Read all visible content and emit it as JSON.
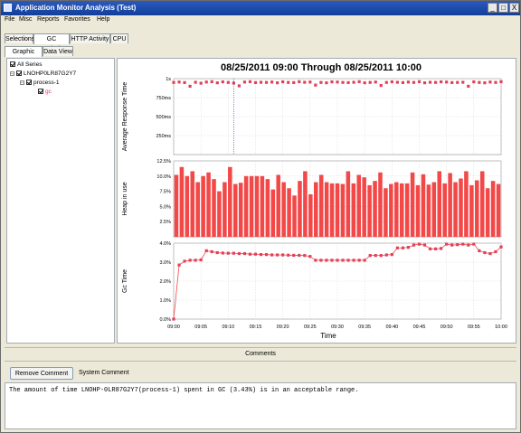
{
  "window": {
    "title": "Application Monitor Analysis (Test)",
    "minimize": "_",
    "maximize": "□",
    "close": "X"
  },
  "menu": [
    "File",
    "Misc",
    "Reports",
    "Favorites",
    "Help"
  ],
  "top_tabs": [
    {
      "label": "Selections",
      "active": false
    },
    {
      "label": "GC Analysis",
      "active": true
    },
    {
      "label": "HTTP Activity",
      "active": false
    },
    {
      "label": "CPU",
      "active": false
    }
  ],
  "sub_tabs": [
    {
      "label": "Graphic View",
      "active": true
    },
    {
      "label": "Data View",
      "active": false
    }
  ],
  "tree": {
    "root": "All Series",
    "host": "LNOHP0LR87G2Y7",
    "process": "process-1",
    "series": "gc",
    "expander": "−"
  },
  "comments": {
    "header": "Comments",
    "remove_button": "Remove Comment",
    "system_label": "System Comment",
    "text": "The amount of time LNOHP-0LR87G2Y7(process-1) spent in GC (3.43%) is in an acceptable range."
  },
  "colors": {
    "series": "#f24848",
    "marker": "#e0405a",
    "accent": "#1f49a8"
  },
  "chart_data": {
    "title": "08/25/2011 09:00 Through 08/25/2011 10:00",
    "xlabel": "Time",
    "x_ticks": [
      "09:00",
      "09:05",
      "09:10",
      "09:15",
      "09:20",
      "09:25",
      "09:30",
      "09:35",
      "09:40",
      "09:45",
      "09:50",
      "09:55",
      "10:00"
    ],
    "x_range_minutes": [
      0,
      60
    ],
    "panels": [
      {
        "type": "scatter",
        "ylabel": "Average Response Time",
        "y_ticks": [
          "1s",
          "750ms",
          "500ms",
          "250ms"
        ],
        "y_tick_values": [
          1000,
          750,
          500,
          250
        ],
        "ylim": [
          0,
          1000
        ],
        "x": [
          0,
          1,
          2,
          3,
          4,
          5,
          6,
          7,
          8,
          9,
          10,
          11,
          12,
          13,
          14,
          15,
          16,
          17,
          18,
          19,
          20,
          21,
          22,
          23,
          24,
          25,
          26,
          27,
          28,
          29,
          30,
          31,
          32,
          33,
          34,
          35,
          36,
          37,
          38,
          39,
          40,
          41,
          42,
          43,
          44,
          45,
          46,
          47,
          48,
          49,
          50,
          51,
          52,
          53,
          54,
          55,
          56,
          57,
          58,
          59,
          60
        ],
        "values": [
          950,
          955,
          948,
          900,
          952,
          940,
          955,
          960,
          945,
          958,
          950,
          942,
          905,
          955,
          960,
          948,
          952,
          950,
          955,
          945,
          958,
          950,
          948,
          960,
          952,
          955,
          915,
          950,
          945,
          958,
          955,
          950,
          948,
          952,
          960,
          945,
          950,
          955,
          910,
          950,
          958,
          952,
          948,
          955,
          950,
          960,
          945,
          952,
          950,
          958,
          955,
          948,
          950,
          952,
          900,
          958,
          950,
          945,
          955,
          950,
          960
        ]
      },
      {
        "type": "bar",
        "ylabel": "Heap in use",
        "y_ticks": [
          "12.5%",
          "10.0%",
          "7.5%",
          "5.0%",
          "2.5%"
        ],
        "y_tick_values": [
          12.5,
          10.0,
          7.5,
          5.0,
          2.5
        ],
        "ylim": [
          0,
          12.5
        ],
        "values": [
          10.2,
          11.5,
          10.0,
          10.8,
          9.0,
          10.0,
          10.6,
          9.5,
          7.5,
          9.0,
          11.5,
          8.7,
          8.9,
          10.0,
          10.0,
          10.0,
          10.0,
          9.5,
          7.8,
          10.2,
          9.0,
          8.0,
          6.8,
          9.2,
          10.8,
          7.0,
          9.0,
          10.2,
          9.0,
          8.8,
          8.8,
          8.7,
          10.8,
          8.8,
          10.2,
          9.8,
          8.5,
          9.2,
          10.6,
          8.0,
          8.7,
          9.0,
          8.8,
          8.8,
          10.6,
          8.5,
          10.3,
          8.6,
          9.0,
          10.8,
          8.8,
          10.5,
          9.0,
          9.6,
          10.8,
          8.5,
          9.3,
          10.8,
          8.0,
          9.2,
          8.7
        ]
      },
      {
        "type": "line",
        "ylabel": "Gc Time",
        "y_ticks": [
          "4.0%",
          "3.0%",
          "2.0%",
          "1.0%",
          "0.0%"
        ],
        "y_tick_values": [
          4.0,
          3.0,
          2.0,
          1.0,
          0.0
        ],
        "ylim": [
          0,
          4.0
        ],
        "x": [
          0,
          1,
          2,
          3,
          4,
          5,
          6,
          7,
          8,
          9,
          10,
          11,
          12,
          13,
          14,
          15,
          16,
          17,
          18,
          19,
          20,
          21,
          22,
          23,
          24,
          25,
          26,
          27,
          28,
          29,
          30,
          31,
          32,
          33,
          34,
          35,
          36,
          37,
          38,
          39,
          40,
          41,
          42,
          43,
          44,
          45,
          46,
          47,
          48,
          49,
          50,
          51,
          52,
          53,
          54,
          55,
          56,
          57,
          58,
          59,
          60
        ],
        "values": [
          0.0,
          2.85,
          3.05,
          3.1,
          3.1,
          3.12,
          3.6,
          3.55,
          3.5,
          3.48,
          3.47,
          3.47,
          3.45,
          3.45,
          3.42,
          3.42,
          3.4,
          3.4,
          3.38,
          3.38,
          3.38,
          3.37,
          3.36,
          3.36,
          3.35,
          3.3,
          3.1,
          3.1,
          3.1,
          3.1,
          3.1,
          3.1,
          3.1,
          3.1,
          3.1,
          3.1,
          3.35,
          3.35,
          3.35,
          3.38,
          3.4,
          3.75,
          3.75,
          3.78,
          3.9,
          3.95,
          3.9,
          3.7,
          3.7,
          3.72,
          3.95,
          3.9,
          3.92,
          3.95,
          3.9,
          3.95,
          3.6,
          3.5,
          3.45,
          3.55,
          3.8
        ]
      }
    ]
  }
}
